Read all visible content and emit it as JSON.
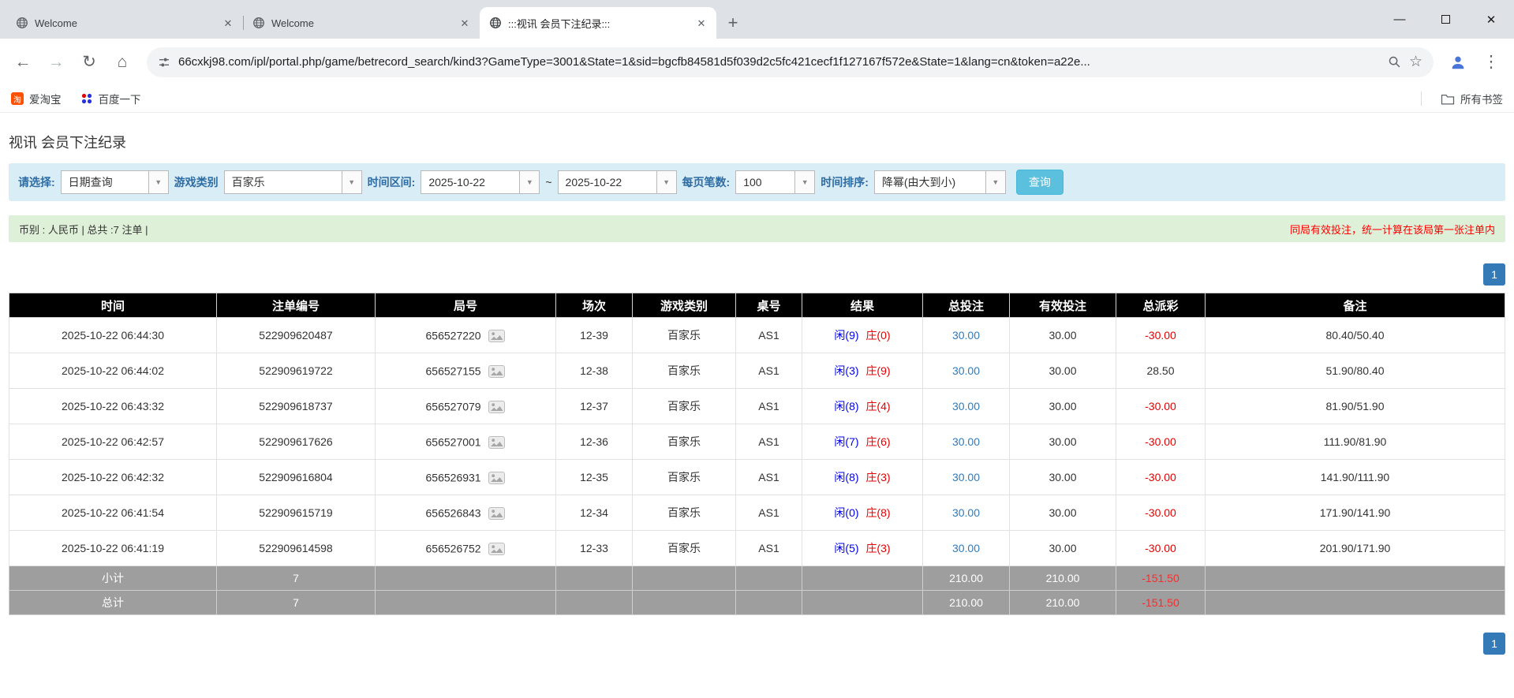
{
  "browser": {
    "tabs": [
      {
        "title": "Welcome"
      },
      {
        "title": "Welcome"
      },
      {
        "title": ":::视讯 会员下注纪录:::"
      }
    ],
    "url": "66cxkj98.com/ipl/portal.php/game/betrecord_search/kind3?GameType=3001&State=1&sid=bgcfb84581d5f039d2c5fc421cecf1f127167f572e&State=1&lang=cn&token=a22e...",
    "bookmarks": {
      "taobao": "爱淘宝",
      "taobao_glyph": "淘",
      "baidu": "百度一下",
      "all": "所有书签"
    }
  },
  "page": {
    "title": "视讯 会员下注纪录",
    "filter": {
      "select_label": "请选择:",
      "select_value": "日期查询",
      "game_label": "游戏类别",
      "game_value": "百家乐",
      "range_label": "时间区间:",
      "date_from": "2025-10-22",
      "tilde": "~",
      "date_to": "2025-10-22",
      "per_page_label": "每页笔数:",
      "per_page_value": "100",
      "sort_label": "时间排序:",
      "sort_value": "降幂(由大到小)",
      "search_button": "查询"
    },
    "summary": {
      "left": "币别 : 人民币 | 总共 :7 注单 |",
      "right": "同局有效投注，统一计算在该局第一张注单内"
    },
    "pagination": {
      "page": "1"
    },
    "table": {
      "headers": [
        "时间",
        "注单编号",
        "局号",
        "场次",
        "游戏类别",
        "桌号",
        "结果",
        "总投注",
        "有效投注",
        "总派彩",
        "备注"
      ],
      "rows": [
        {
          "time": "2025-10-22 06:44:30",
          "bet_id": "522909620487",
          "round_id": "656527220",
          "session": "12-39",
          "game": "百家乐",
          "table_no": "AS1",
          "result_xian": "闲(9)",
          "result_zhuang": "庄(0)",
          "total_bet": "30.00",
          "valid_bet": "30.00",
          "payout": "-30.00",
          "note": "80.40/50.40"
        },
        {
          "time": "2025-10-22 06:44:02",
          "bet_id": "522909619722",
          "round_id": "656527155",
          "session": "12-38",
          "game": "百家乐",
          "table_no": "AS1",
          "result_xian": "闲(3)",
          "result_zhuang": "庄(9)",
          "total_bet": "30.00",
          "valid_bet": "30.00",
          "payout": "28.50",
          "note": "51.90/80.40"
        },
        {
          "time": "2025-10-22 06:43:32",
          "bet_id": "522909618737",
          "round_id": "656527079",
          "session": "12-37",
          "game": "百家乐",
          "table_no": "AS1",
          "result_xian": "闲(8)",
          "result_zhuang": "庄(4)",
          "total_bet": "30.00",
          "valid_bet": "30.00",
          "payout": "-30.00",
          "note": "81.90/51.90"
        },
        {
          "time": "2025-10-22 06:42:57",
          "bet_id": "522909617626",
          "round_id": "656527001",
          "session": "12-36",
          "game": "百家乐",
          "table_no": "AS1",
          "result_xian": "闲(7)",
          "result_zhuang": "庄(6)",
          "total_bet": "30.00",
          "valid_bet": "30.00",
          "payout": "-30.00",
          "note": "111.90/81.90"
        },
        {
          "time": "2025-10-22 06:42:32",
          "bet_id": "522909616804",
          "round_id": "656526931",
          "session": "12-35",
          "game": "百家乐",
          "table_no": "AS1",
          "result_xian": "闲(8)",
          "result_zhuang": "庄(3)",
          "total_bet": "30.00",
          "valid_bet": "30.00",
          "payout": "-30.00",
          "note": "141.90/111.90"
        },
        {
          "time": "2025-10-22 06:41:54",
          "bet_id": "522909615719",
          "round_id": "656526843",
          "session": "12-34",
          "game": "百家乐",
          "table_no": "AS1",
          "result_xian": "闲(0)",
          "result_zhuang": "庄(8)",
          "total_bet": "30.00",
          "valid_bet": "30.00",
          "payout": "-30.00",
          "note": "171.90/141.90"
        },
        {
          "time": "2025-10-22 06:41:19",
          "bet_id": "522909614598",
          "round_id": "656526752",
          "session": "12-33",
          "game": "百家乐",
          "table_no": "AS1",
          "result_xian": "闲(5)",
          "result_zhuang": "庄(3)",
          "total_bet": "30.00",
          "valid_bet": "30.00",
          "payout": "-30.00",
          "note": "201.90/171.90"
        }
      ],
      "subtotal": {
        "label": "小计",
        "count": "7",
        "total_bet": "210.00",
        "valid_bet": "210.00",
        "payout": "-151.50"
      },
      "total": {
        "label": "总计",
        "count": "7",
        "total_bet": "210.00",
        "valid_bet": "210.00",
        "payout": "-151.50"
      }
    }
  }
}
